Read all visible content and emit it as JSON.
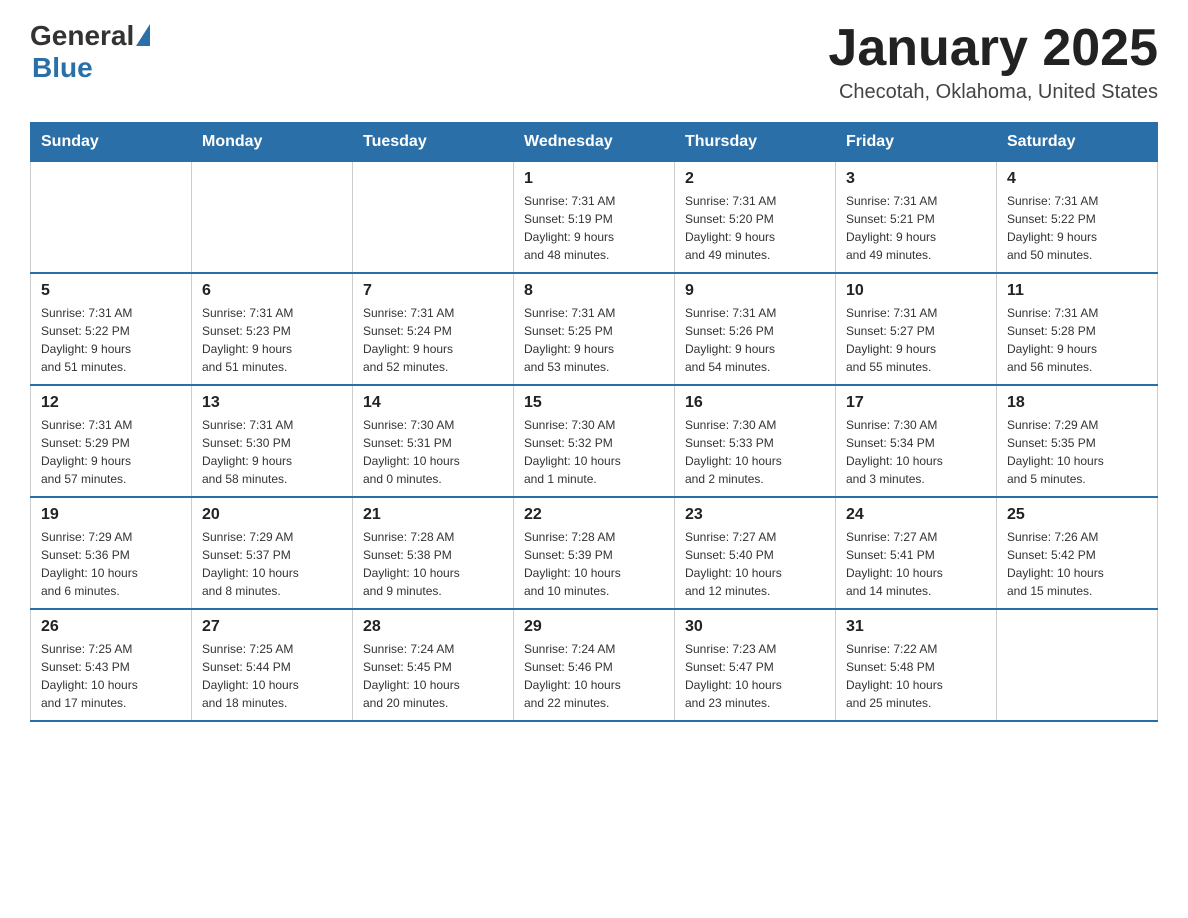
{
  "header": {
    "logo_general": "General",
    "logo_blue": "Blue",
    "month_title": "January 2025",
    "location": "Checotah, Oklahoma, United States"
  },
  "days_of_week": [
    "Sunday",
    "Monday",
    "Tuesday",
    "Wednesday",
    "Thursday",
    "Friday",
    "Saturday"
  ],
  "weeks": [
    [
      {
        "day": "",
        "info": ""
      },
      {
        "day": "",
        "info": ""
      },
      {
        "day": "",
        "info": ""
      },
      {
        "day": "1",
        "info": "Sunrise: 7:31 AM\nSunset: 5:19 PM\nDaylight: 9 hours\nand 48 minutes."
      },
      {
        "day": "2",
        "info": "Sunrise: 7:31 AM\nSunset: 5:20 PM\nDaylight: 9 hours\nand 49 minutes."
      },
      {
        "day": "3",
        "info": "Sunrise: 7:31 AM\nSunset: 5:21 PM\nDaylight: 9 hours\nand 49 minutes."
      },
      {
        "day": "4",
        "info": "Sunrise: 7:31 AM\nSunset: 5:22 PM\nDaylight: 9 hours\nand 50 minutes."
      }
    ],
    [
      {
        "day": "5",
        "info": "Sunrise: 7:31 AM\nSunset: 5:22 PM\nDaylight: 9 hours\nand 51 minutes."
      },
      {
        "day": "6",
        "info": "Sunrise: 7:31 AM\nSunset: 5:23 PM\nDaylight: 9 hours\nand 51 minutes."
      },
      {
        "day": "7",
        "info": "Sunrise: 7:31 AM\nSunset: 5:24 PM\nDaylight: 9 hours\nand 52 minutes."
      },
      {
        "day": "8",
        "info": "Sunrise: 7:31 AM\nSunset: 5:25 PM\nDaylight: 9 hours\nand 53 minutes."
      },
      {
        "day": "9",
        "info": "Sunrise: 7:31 AM\nSunset: 5:26 PM\nDaylight: 9 hours\nand 54 minutes."
      },
      {
        "day": "10",
        "info": "Sunrise: 7:31 AM\nSunset: 5:27 PM\nDaylight: 9 hours\nand 55 minutes."
      },
      {
        "day": "11",
        "info": "Sunrise: 7:31 AM\nSunset: 5:28 PM\nDaylight: 9 hours\nand 56 minutes."
      }
    ],
    [
      {
        "day": "12",
        "info": "Sunrise: 7:31 AM\nSunset: 5:29 PM\nDaylight: 9 hours\nand 57 minutes."
      },
      {
        "day": "13",
        "info": "Sunrise: 7:31 AM\nSunset: 5:30 PM\nDaylight: 9 hours\nand 58 minutes."
      },
      {
        "day": "14",
        "info": "Sunrise: 7:30 AM\nSunset: 5:31 PM\nDaylight: 10 hours\nand 0 minutes."
      },
      {
        "day": "15",
        "info": "Sunrise: 7:30 AM\nSunset: 5:32 PM\nDaylight: 10 hours\nand 1 minute."
      },
      {
        "day": "16",
        "info": "Sunrise: 7:30 AM\nSunset: 5:33 PM\nDaylight: 10 hours\nand 2 minutes."
      },
      {
        "day": "17",
        "info": "Sunrise: 7:30 AM\nSunset: 5:34 PM\nDaylight: 10 hours\nand 3 minutes."
      },
      {
        "day": "18",
        "info": "Sunrise: 7:29 AM\nSunset: 5:35 PM\nDaylight: 10 hours\nand 5 minutes."
      }
    ],
    [
      {
        "day": "19",
        "info": "Sunrise: 7:29 AM\nSunset: 5:36 PM\nDaylight: 10 hours\nand 6 minutes."
      },
      {
        "day": "20",
        "info": "Sunrise: 7:29 AM\nSunset: 5:37 PM\nDaylight: 10 hours\nand 8 minutes."
      },
      {
        "day": "21",
        "info": "Sunrise: 7:28 AM\nSunset: 5:38 PM\nDaylight: 10 hours\nand 9 minutes."
      },
      {
        "day": "22",
        "info": "Sunrise: 7:28 AM\nSunset: 5:39 PM\nDaylight: 10 hours\nand 10 minutes."
      },
      {
        "day": "23",
        "info": "Sunrise: 7:27 AM\nSunset: 5:40 PM\nDaylight: 10 hours\nand 12 minutes."
      },
      {
        "day": "24",
        "info": "Sunrise: 7:27 AM\nSunset: 5:41 PM\nDaylight: 10 hours\nand 14 minutes."
      },
      {
        "day": "25",
        "info": "Sunrise: 7:26 AM\nSunset: 5:42 PM\nDaylight: 10 hours\nand 15 minutes."
      }
    ],
    [
      {
        "day": "26",
        "info": "Sunrise: 7:25 AM\nSunset: 5:43 PM\nDaylight: 10 hours\nand 17 minutes."
      },
      {
        "day": "27",
        "info": "Sunrise: 7:25 AM\nSunset: 5:44 PM\nDaylight: 10 hours\nand 18 minutes."
      },
      {
        "day": "28",
        "info": "Sunrise: 7:24 AM\nSunset: 5:45 PM\nDaylight: 10 hours\nand 20 minutes."
      },
      {
        "day": "29",
        "info": "Sunrise: 7:24 AM\nSunset: 5:46 PM\nDaylight: 10 hours\nand 22 minutes."
      },
      {
        "day": "30",
        "info": "Sunrise: 7:23 AM\nSunset: 5:47 PM\nDaylight: 10 hours\nand 23 minutes."
      },
      {
        "day": "31",
        "info": "Sunrise: 7:22 AM\nSunset: 5:48 PM\nDaylight: 10 hours\nand 25 minutes."
      },
      {
        "day": "",
        "info": ""
      }
    ]
  ]
}
